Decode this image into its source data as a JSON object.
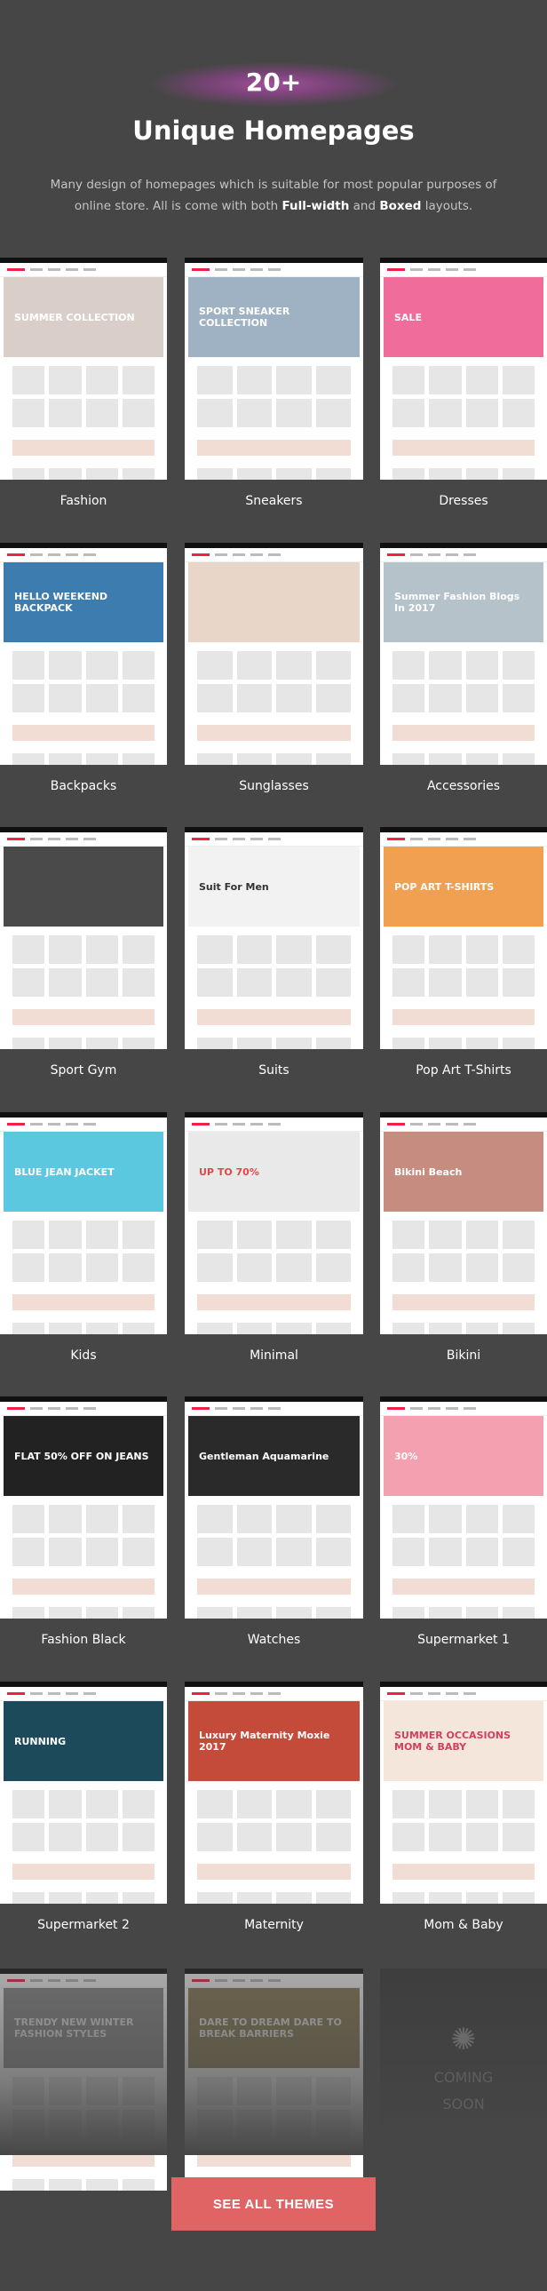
{
  "header": {
    "badge": "20+",
    "title": "Unique Homepages",
    "desc_pre": "Many design of homepages which is suitable for most popular purposes of online store. All is come with both ",
    "bold1": "Full-width",
    "mid": " and ",
    "bold2": "Boxed",
    "post": " layouts."
  },
  "themes": [
    {
      "name": "Fashion",
      "hero": "SUMMER COLLECTION",
      "color": "#d9cfc8",
      "text": "#ffffff"
    },
    {
      "name": "Sneakers",
      "hero": "SPORT SNEAKER COLLECTION",
      "color": "#9fb2c4",
      "text": "#ffffff"
    },
    {
      "name": "Dresses",
      "hero": "SALE",
      "color": "#f06c9b",
      "text": "#ffffff"
    },
    {
      "name": "Backpacks",
      "hero": "HELLO WEEKEND BACKPACK",
      "color": "#3c7cae",
      "text": "#ffffff"
    },
    {
      "name": "Sunglasses",
      "hero": "",
      "color": "#e8d6c8",
      "text": "#ffffff"
    },
    {
      "name": "Accessories",
      "hero": "Summer Fashion Blogs In 2017",
      "color": "#b6c2ca",
      "text": "#ffffff"
    },
    {
      "name": "Sport Gym",
      "hero": "",
      "color": "#4a4a4a",
      "text": "#ffffff"
    },
    {
      "name": "Suits",
      "hero": "Suit For Men",
      "color": "#f2f2f2",
      "text": "#333333"
    },
    {
      "name": "Pop Art T-Shirts",
      "hero": "POP ART T-SHIRTS",
      "color": "#f0a050",
      "text": "#ffffff"
    },
    {
      "name": "Kids",
      "hero": "BLUE JEAN JACKET",
      "color": "#5bc8e0",
      "text": "#ffffff"
    },
    {
      "name": "Minimal",
      "hero": "UP TO 70%",
      "color": "#e9e9e9",
      "text": "#e04848"
    },
    {
      "name": "Bikini",
      "hero": "Bikini Beach",
      "color": "#c68c80",
      "text": "#ffffff"
    },
    {
      "name": "Fashion Black",
      "hero": "FLAT 50% OFF ON JEANS",
      "color": "#222222",
      "text": "#ffffff"
    },
    {
      "name": "Watches",
      "hero": "Gentleman Aquamarine",
      "color": "#2a2a2a",
      "text": "#ffffff"
    },
    {
      "name": "Supermarket 1",
      "hero": "30%",
      "color": "#f3a0b0",
      "text": "#ffffff"
    },
    {
      "name": "Supermarket 2",
      "hero": "RUNNING",
      "color": "#1d4a5a",
      "text": "#ffffff"
    },
    {
      "name": "Maternity",
      "hero": "Luxury Maternity Moxie 2017",
      "color": "#c44a3a",
      "text": "#ffffff"
    },
    {
      "name": "Mom & Baby",
      "hero": "SUMMER OCCASIONS MOM & BABY",
      "color": "#f5e6dc",
      "text": "#d04060"
    }
  ],
  "upcoming": [
    {
      "hero": "TRENDY NEW WINTER FASHION STYLES",
      "color": "#8a8a8a"
    },
    {
      "hero": "DARE TO DREAM DARE TO BREAK BARRIERS",
      "color": "#8a7a50"
    }
  ],
  "coming_soon": "COMING SOON",
  "cta": "SEE ALL THEMES",
  "colors": {
    "background": "#464646",
    "accent": "#e06464",
    "badge": "#a0509a"
  }
}
